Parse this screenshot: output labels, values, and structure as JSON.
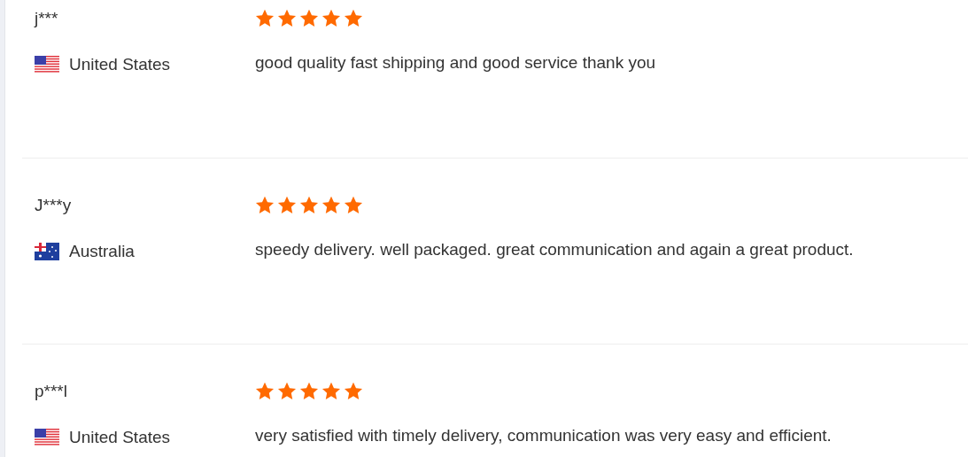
{
  "reviews": [
    {
      "name": "j***",
      "country": "United States",
      "kind": "us",
      "stars": 5,
      "text": "good quality fast shipping and good service thank you"
    },
    {
      "name": "J***y",
      "country": "Australia",
      "kind": "au",
      "stars": 5,
      "text": "speedy delivery. well packaged. great communication and again a great product."
    },
    {
      "name": "p***l",
      "country": "United States",
      "kind": "us",
      "stars": 5,
      "text": "very satisfied with timely delivery, communication was very easy and efficient."
    }
  ]
}
